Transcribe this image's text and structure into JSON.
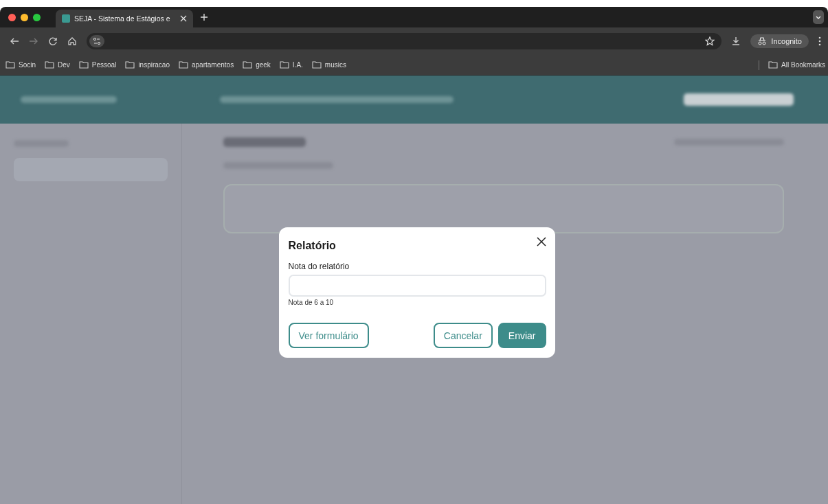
{
  "browser": {
    "tabs": [
      {
        "title": "SEJA - Sistema de Estágios e",
        "selected": true
      }
    ],
    "incognito_label": "Incognito",
    "bookmarks": [
      "Socin",
      "Dev",
      "Pessoal",
      "inspiracao",
      "apartamentos",
      "geek",
      "I.A.",
      "musics"
    ],
    "all_bookmarks": "All Bookmarks"
  },
  "dialog": {
    "title": "Relatório",
    "field_label": "Nota do relatório",
    "field_hint": "Nota de 6 a 10",
    "buttons": [
      {
        "label": "Ver formulário",
        "kind": "outline"
      },
      {
        "label": "Cancelar",
        "kind": "outline"
      },
      {
        "label": "Enviar",
        "kind": "primary"
      }
    ]
  }
}
